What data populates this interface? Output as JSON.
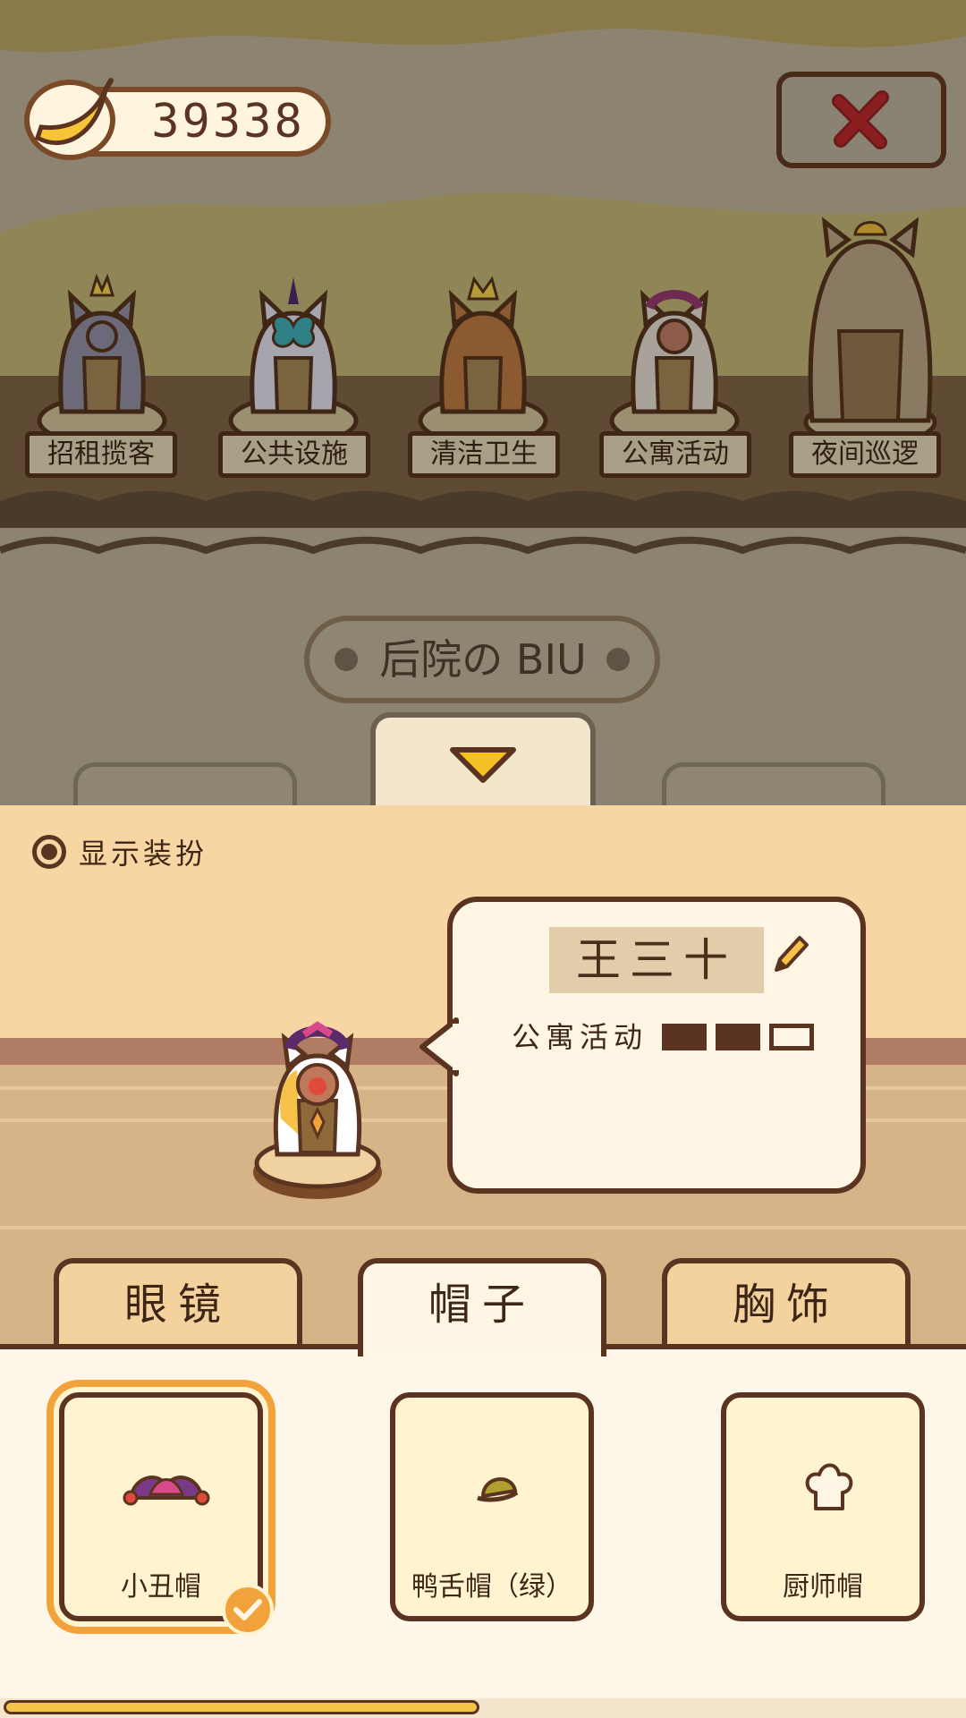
{
  "currency": {
    "value": "39338",
    "icon": "banana-icon"
  },
  "close": {
    "icon": "close-icon",
    "color": "#8B1E1E"
  },
  "cats": [
    {
      "label": "招租揽客"
    },
    {
      "label": "公共设施"
    },
    {
      "label": "清洁卫生"
    },
    {
      "label": "公寓活动"
    },
    {
      "label": "夜间巡逻"
    }
  ],
  "area_title": "后院の BIU",
  "show_outfit": {
    "label": "显示装扮",
    "checked": true
  },
  "character": {
    "name": "王三十",
    "role": "公寓活动",
    "level": 2,
    "level_max": 3
  },
  "tabs": [
    {
      "label": "眼镜",
      "active": false
    },
    {
      "label": "帽子",
      "active": true
    },
    {
      "label": "胸饰",
      "active": false
    }
  ],
  "items": [
    {
      "label": "小丑帽",
      "icon": "jester-hat-icon",
      "selected": true
    },
    {
      "label": "鸭舌帽（绿）",
      "icon": "green-cap-icon",
      "selected": false
    },
    {
      "label": "厨师帽",
      "icon": "chef-hat-icon",
      "selected": false
    }
  ],
  "colors": {
    "accent": "#F2A23A",
    "outline": "#5A3420",
    "panel": "#F8D6A4"
  }
}
